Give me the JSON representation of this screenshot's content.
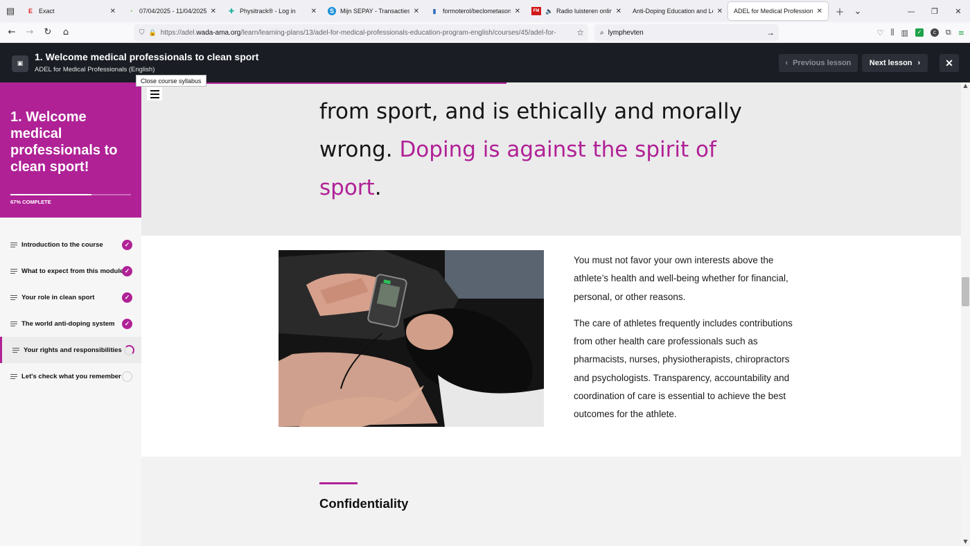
{
  "browser": {
    "tabs": [
      {
        "title": "Exact",
        "favicon": "E",
        "color": "#e02020"
      },
      {
        "title": "07/04/2025 - 11/04/2025",
        "favicon": "◔",
        "color": "#6cc04a"
      },
      {
        "title": "Physitrack® - Log in",
        "favicon": "✚",
        "color": "#25b5a0"
      },
      {
        "title": "Mijn SEPAY - Transacties",
        "favicon": "S",
        "color": "#1a8fd6"
      },
      {
        "title": "formoterol/beclometason",
        "favicon": "▮",
        "color": "#3a6fb8"
      },
      {
        "title": "Radio luisteren online -",
        "favicon": "FM",
        "color": "#d01a1a"
      },
      {
        "title": "Anti-Doping Education and Lea",
        "favicon": "",
        "color": "#b02196"
      },
      {
        "title": "ADEL for Medical Professionals",
        "favicon": "",
        "color": "#b02196"
      }
    ],
    "url_prefix": "https://adel.",
    "url_domain": "wada-ama.org",
    "url_path": "/learn/learning-plans/13/adel-for-medical-professionals-education-program-english/courses/45/adel-for-",
    "search_value": "lymphevten"
  },
  "course": {
    "lesson_title": "1. Welcome medical professionals to clean sport",
    "course_subtitle": "ADEL for Medical Professionals (English)",
    "prev_label": "Previous lesson",
    "next_label": "Next lesson",
    "tooltip": "Close course syllabus"
  },
  "sidebar": {
    "title": "1. Welcome medical professionals to clean sport!",
    "progress_percent": 67,
    "progress_label": "67% COMPLETE",
    "items": [
      {
        "label": "Introduction to the course",
        "status": "done"
      },
      {
        "label": "What to expect from this module",
        "status": "done"
      },
      {
        "label": "Your role in clean sport",
        "status": "done"
      },
      {
        "label": "The world anti-doping system",
        "status": "done"
      },
      {
        "label": "Your rights and responsibilities",
        "status": "in-progress"
      },
      {
        "label": "Let's check what you remember",
        "status": "not-started"
      }
    ]
  },
  "content": {
    "quote_plain_1": "from sport, and is ethically and morally",
    "quote_plain_2": "wrong.",
    "quote_highlight_a": "Doping is against the spirit of",
    "quote_highlight_b": "sport",
    "quote_end": ".",
    "paragraph_1": "You must not favor your own interests above the athlete’s health and well-being whether for financial, personal, or other reasons.",
    "paragraph_2": "The care of athletes frequently includes contributions from other health care professionals such as pharmacists, nurses, physiotherapists, chiropractors and psychologists. Transparency, accountability and coordination of care is essential to achieve the best outcomes for the athlete.",
    "section_heading": "Confidentiality"
  },
  "colors": {
    "accent": "#b02196",
    "header_bg": "#1a1d24"
  }
}
